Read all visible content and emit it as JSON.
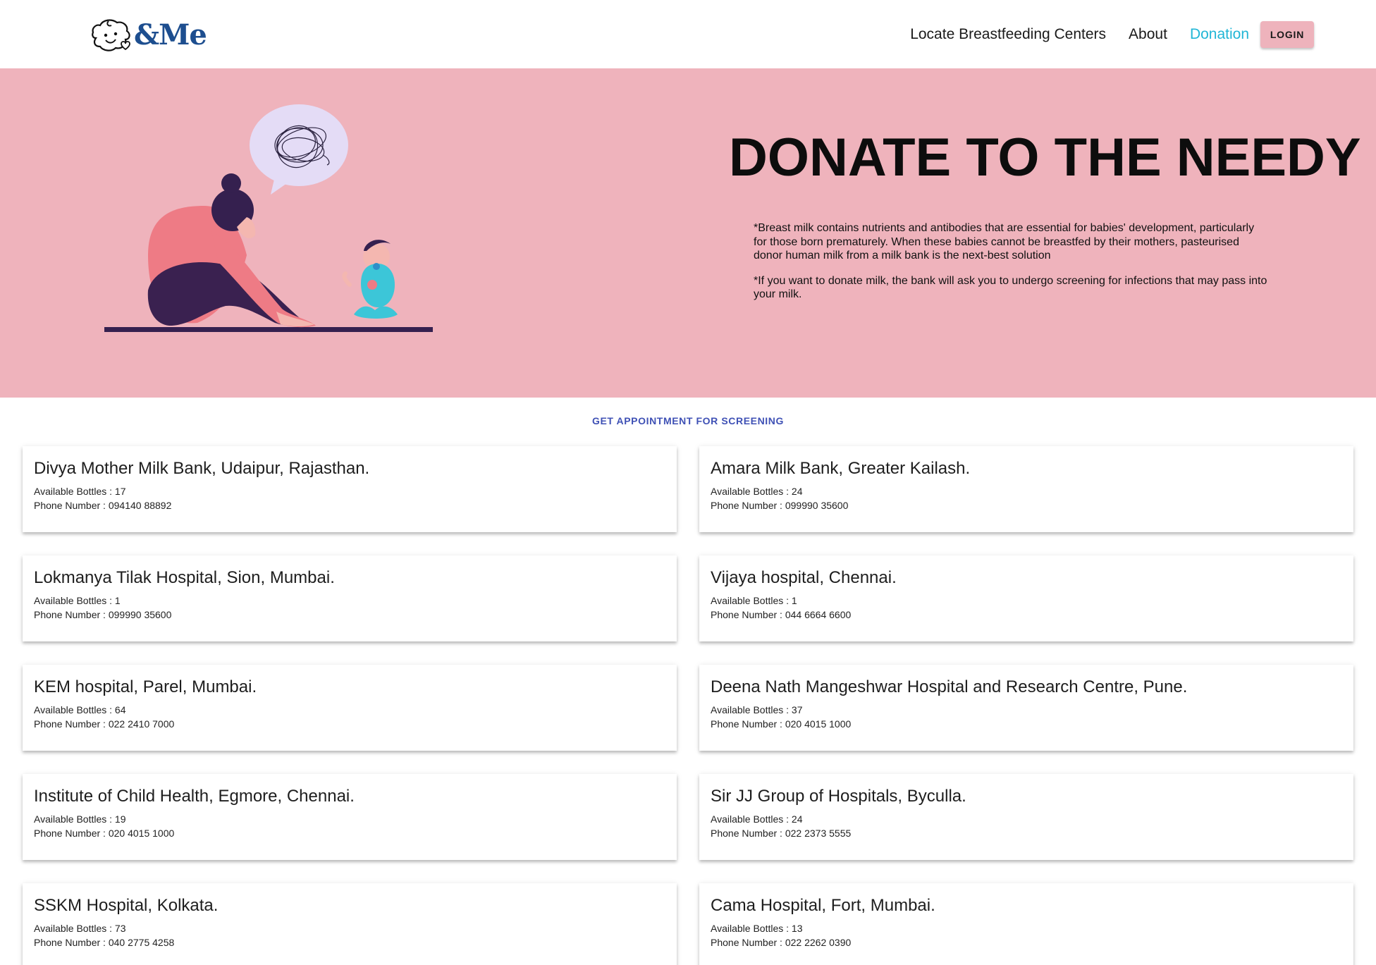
{
  "header": {
    "logo_text": "&Me",
    "nav": [
      {
        "label": "Locate Breastfeeding Centers"
      },
      {
        "label": "About"
      },
      {
        "label": "Donation"
      }
    ],
    "login_label": "LOGIN",
    "accent_color": "#21b6d6"
  },
  "hero": {
    "title": "DONATE TO THE NEEDY",
    "paragraphs": [
      "*Breast milk contains nutrients and antibodies that are essential for babies' development, particularly for those born prematurely. When these babies cannot be breastfed by their mothers, pasteurised donor human milk from a milk bank is the next-best solution",
      "*If you want to donate milk, the bank will ask you to undergo screening for infections that may pass into your milk."
    ],
    "background": "#efb3bc"
  },
  "section": {
    "link_label": "GET APPOINTMENT FOR SCREENING"
  },
  "labels": {
    "bottles_prefix": "Available Bottles : ",
    "phone_prefix": "Phone Number : "
  },
  "banks": [
    {
      "name": "Divya Mother Milk Bank, Udaipur, Rajasthan.",
      "bottles": "17",
      "phone": "094140 88892"
    },
    {
      "name": "Amara Milk Bank, Greater Kailash.",
      "bottles": "24",
      "phone": "099990 35600"
    },
    {
      "name": "Lokmanya Tilak Hospital, Sion, Mumbai.",
      "bottles": "1",
      "phone": "099990 35600"
    },
    {
      "name": "Vijaya hospital, Chennai.",
      "bottles": "1",
      "phone": "044 6664 6600"
    },
    {
      "name": "KEM hospital, Parel, Mumbai.",
      "bottles": "64",
      "phone": "022 2410 7000"
    },
    {
      "name": "Deena Nath Mangeshwar Hospital and Research Centre, Pune.",
      "bottles": "37",
      "phone": "020 4015 1000"
    },
    {
      "name": "Institute of Child Health, Egmore, Chennai.",
      "bottles": "19",
      "phone": "020 4015 1000"
    },
    {
      "name": "Sir JJ Group of Hospitals, Byculla.",
      "bottles": "24",
      "phone": "022 2373 5555"
    },
    {
      "name": "SSKM Hospital, Kolkata.",
      "bottles": "73",
      "phone": "040 2775 4258"
    },
    {
      "name": "Cama Hospital, Fort, Mumbai.",
      "bottles": "13",
      "phone": "022 2262 0390"
    }
  ]
}
